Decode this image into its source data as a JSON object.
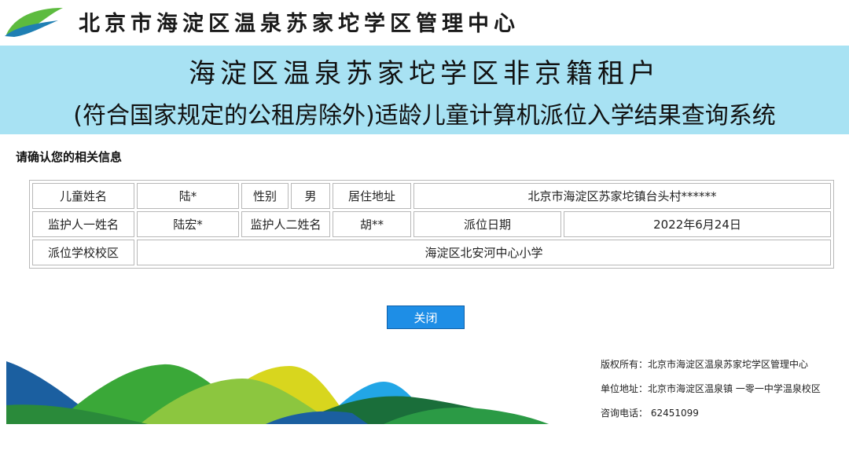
{
  "header": {
    "org_name": "北京市海淀区温泉苏家坨学区管理中心",
    "logo_icon": "leaf-logo-icon"
  },
  "banner": {
    "title_line1": "海淀区温泉苏家坨学区非京籍租户",
    "title_line2": "(符合国家规定的公租房除外)适龄儿童计算机派位入学结果查询系统",
    "background": "#a8e2f3"
  },
  "confirm_label": "请确认您的相关信息",
  "info": {
    "child_name_label": "儿童姓名",
    "child_name": "陆*",
    "gender_label": "性别",
    "gender": "男",
    "address_label": "居住地址",
    "address": "北京市海淀区苏家坨镇台头村******",
    "guardian1_label": "监护人一姓名",
    "guardian1": "陆宏*",
    "guardian2_label": "监护人二姓名",
    "guardian2": "胡**",
    "date_label": "派位日期",
    "date": "2022年6月24日",
    "school_label": "派位学校校区",
    "school": "海淀区北安河中心小学"
  },
  "close_button": {
    "label": "关闭",
    "color": "#1e8ee6"
  },
  "footer": {
    "copyright": "版权所有：北京市海淀区温泉苏家坨学区管理中心",
    "address": "单位地址：北京市海淀区温泉镇 一零一中学温泉校区",
    "phone": "咨询电话： 62451099"
  }
}
